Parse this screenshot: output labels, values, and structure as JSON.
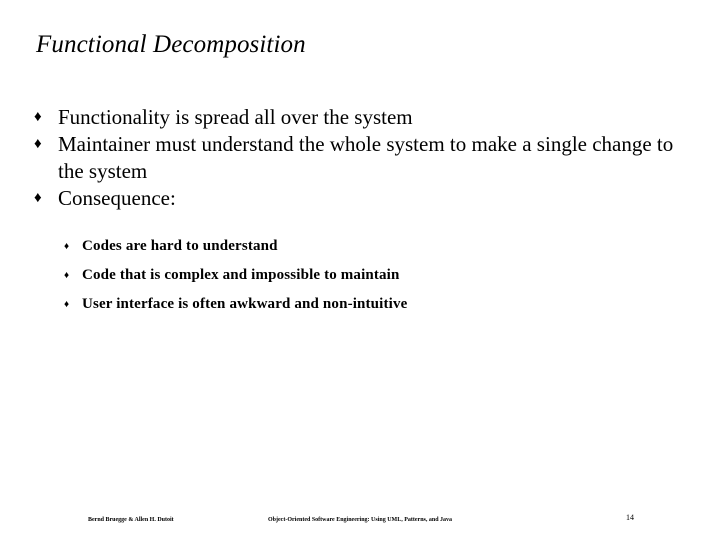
{
  "slide": {
    "title": "Functional Decomposition",
    "bullet_glyph": "♦",
    "sub_bullet_glyph": "♦",
    "text_color": "#000000",
    "background_color": "#ffffff",
    "bullets": [
      {
        "text": "Functionality is spread all over the system"
      },
      {
        "text": "Maintainer must understand the whole system to make a single change to the system"
      },
      {
        "text": "Consequence:"
      }
    ],
    "sub_bullets": [
      {
        "text": "Codes are hard to understand"
      },
      {
        "text": "Code that is complex and impossible to maintain"
      },
      {
        "text": "User interface is often awkward and non-intuitive"
      }
    ]
  },
  "footer": {
    "authors": "Bernd Bruegge & Allen H. Dutoit",
    "book_title": "Object-Oriented Software Engineering: Using UML, Patterns, and Java",
    "page_number": "14"
  }
}
